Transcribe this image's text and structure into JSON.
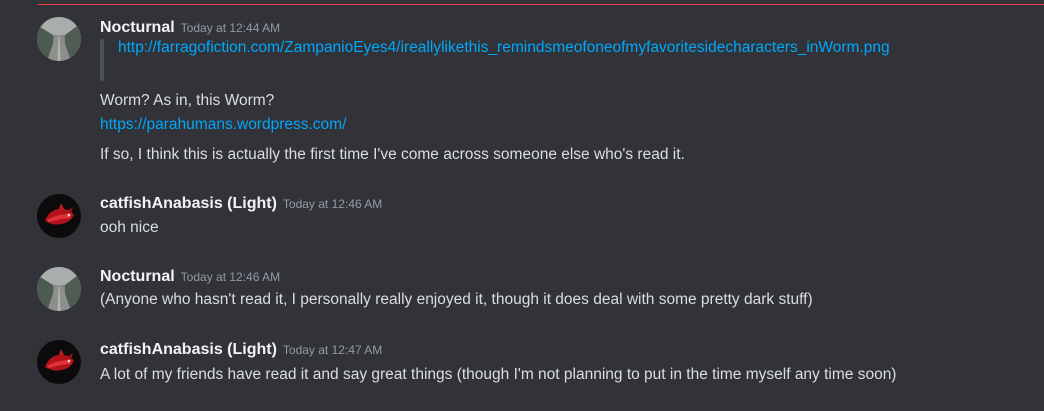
{
  "messages": [
    {
      "author": "Nocturnal",
      "timestamp": "Today at 12:44 AM",
      "avatar": "road-avatar",
      "quote": "http://farragofiction.com/ZampanioEyes4/ireallylikethis_remindsmeofoneofmyfavoritesidecharacters_inWorm.png",
      "lines": [
        "Worm? As in, this Worm?",
        "https://parahumans.wordpress.com/",
        "If so, I think this is actually the first time I've come across someone else who's read it."
      ]
    },
    {
      "author": "catfishAnabasis (Light)",
      "timestamp": "Today at 12:46 AM",
      "avatar": "red-creature-avatar",
      "lines": [
        "ooh nice"
      ]
    },
    {
      "author": "Nocturnal",
      "timestamp": "Today at 12:46 AM",
      "avatar": "road-avatar",
      "lines": [
        "(Anyone who hasn't read it, I personally really enjoyed it, though it does deal with some pretty dark stuff)"
      ]
    },
    {
      "author": "catfishAnabasis (Light)",
      "timestamp": "Today at 12:47 AM",
      "avatar": "red-creature-avatar",
      "lines": [
        "A lot of my friends have read it and say great things (though I'm not planning to put in the time myself any time soon)"
      ]
    }
  ],
  "colors": {
    "background": "#313338",
    "link": "#00a8fc",
    "username": "#f2f3f5",
    "timestamp": "#949ba4",
    "text": "#dbdee1",
    "new_divider": "#f23f43"
  }
}
